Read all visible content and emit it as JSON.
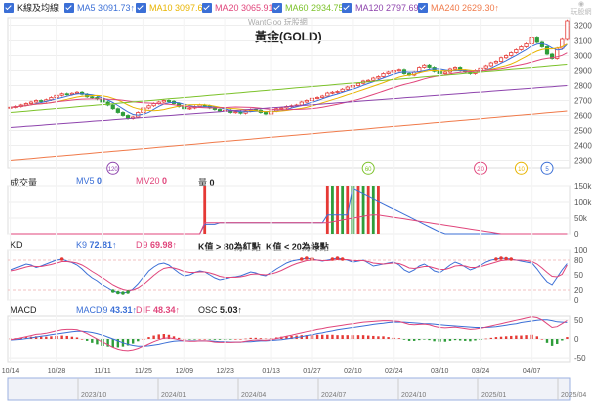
{
  "legend": {
    "main": "K線及均線",
    "ma5": "MA5 3091.73↑",
    "ma10": "MA10 3097.60↑",
    "ma20": "MA20 3065.91↑",
    "ma60": "MA60 2934.75↑",
    "ma120": "MA120 2797.69↑",
    "ma240": "MA240 2629.30↑"
  },
  "watermark": "WantGoo 玩股網",
  "logo": "玩股網",
  "title": "黃金(GOLD)",
  "volume": {
    "label": "成交量",
    "mv5": "MV5",
    "mv5_val": "0",
    "mv20": "MV20",
    "mv20_val": "0",
    "vol": "量",
    "vol_val": "0"
  },
  "kd": {
    "label": "KD",
    "k": "K9",
    "k_val": "72.81↑",
    "d": "D9",
    "d_val": "69.98↑",
    "note1": "K值 > 80為紅點",
    "note2": "K值 < 20為綠點"
  },
  "macd": {
    "label": "MACD",
    "macd": "MACD9",
    "macd_val": "43.31↑",
    "dif": "DIF",
    "dif_val": "48.34↑",
    "osc": "OSC",
    "osc_val": "5.03↑"
  },
  "ma_markers": [
    "120",
    "60",
    "20",
    "10",
    "5"
  ],
  "colors": {
    "ma5": "#3b6fd6",
    "ma10": "#e8b400",
    "ma20": "#e0457b",
    "ma60": "#7cc22a",
    "ma120": "#8e44ad",
    "ma240": "#f07a4a",
    "up": "#e53935",
    "down": "#2e9d3a"
  },
  "chart_data": {
    "type": "candlestick",
    "x_ticks": [
      "10/14",
      "10/28",
      "11/11",
      "11/25",
      "12/09",
      "12/23",
      "01/13",
      "01/27",
      "02/10",
      "02/24",
      "03/10",
      "03/24",
      "04/07"
    ],
    "price_ticks": [
      2300,
      2400,
      2500,
      2600,
      2700,
      2800,
      2900,
      3000,
      3100,
      3200
    ],
    "volume_ticks": [
      "150k",
      "100k",
      "50k",
      "0"
    ],
    "kd_ticks": [
      100,
      80,
      50,
      20,
      0
    ],
    "macd_ticks": [
      50,
      0,
      -50
    ],
    "timeline": [
      "2023/10",
      "2024/01",
      "2024/04",
      "2024/07",
      "2024/10",
      "2025/01",
      "2025/04"
    ],
    "close": [
      2655,
      2660,
      2670,
      2680,
      2690,
      2700,
      2695,
      2705,
      2720,
      2735,
      2745,
      2740,
      2748,
      2755,
      2742,
      2725,
      2720,
      2710,
      2690,
      2670,
      2645,
      2620,
      2600,
      2580,
      2590,
      2620,
      2650,
      2665,
      2680,
      2690,
      2700,
      2695,
      2680,
      2660,
      2645,
      2650,
      2660,
      2670,
      2665,
      2650,
      2640,
      2630,
      2635,
      2620,
      2625,
      2615,
      2630,
      2640,
      2635,
      2620,
      2610,
      2630,
      2645,
      2650,
      2660,
      2665,
      2670,
      2690,
      2700,
      2715,
      2720,
      2730,
      2750,
      2755,
      2760,
      2775,
      2790,
      2800,
      2815,
      2830,
      2835,
      2850,
      2860,
      2880,
      2890,
      2900,
      2905,
      2880,
      2870,
      2890,
      2920,
      2935,
      2920,
      2895,
      2880,
      2890,
      2910,
      2920,
      2900,
      2890,
      2880,
      2900,
      2915,
      2930,
      2950,
      2960,
      2985,
      3000,
      3020,
      3040,
      3060,
      3080,
      3120,
      3090,
      3060,
      3010,
      2980,
      3050,
      3110,
      3230
    ],
    "kd_k": [
      60,
      64,
      68,
      72,
      70,
      65,
      68,
      72,
      76,
      80,
      82,
      78,
      75,
      70,
      62,
      52,
      44,
      38,
      30,
      24,
      18,
      15,
      14,
      16,
      22,
      32,
      45,
      58,
      66,
      72,
      74,
      70,
      62,
      54,
      48,
      50,
      55,
      58,
      56,
      50,
      44,
      40,
      42,
      45,
      46,
      48,
      52,
      56,
      54,
      50,
      48,
      55,
      62,
      68,
      74,
      78,
      80,
      82,
      84,
      82,
      80,
      78,
      80,
      82,
      84,
      82,
      80,
      76,
      78,
      80,
      74,
      68,
      70,
      72,
      74,
      76,
      70,
      60,
      55,
      60,
      68,
      72,
      66,
      58,
      55,
      62,
      70,
      76,
      72,
      66,
      60,
      64,
      70,
      76,
      80,
      82,
      84,
      83,
      82,
      80,
      78,
      76,
      74,
      62,
      48,
      36,
      30,
      45,
      60,
      72.81
    ],
    "kd_d": [
      58,
      60,
      63,
      66,
      68,
      67,
      67,
      69,
      71,
      74,
      77,
      77,
      76,
      74,
      70,
      64,
      57,
      51,
      44,
      37,
      30,
      25,
      21,
      19,
      20,
      24,
      31,
      40,
      49,
      57,
      63,
      65,
      64,
      61,
      57,
      55,
      55,
      56,
      56,
      54,
      51,
      47,
      45,
      45,
      45,
      46,
      48,
      51,
      52,
      51,
      50,
      52,
      55,
      59,
      64,
      69,
      73,
      76,
      79,
      80,
      80,
      79,
      79,
      80,
      81,
      81,
      81,
      79,
      79,
      79,
      77,
      74,
      73,
      72,
      73,
      74,
      73,
      69,
      64,
      63,
      65,
      67,
      67,
      64,
      61,
      61,
      64,
      68,
      69,
      68,
      65,
      65,
      67,
      70,
      73,
      76,
      79,
      80,
      81,
      80,
      80,
      79,
      77,
      72,
      64,
      55,
      47,
      46,
      51,
      69.98
    ],
    "macd_dif": [
      -2,
      0,
      3,
      6,
      9,
      12,
      13,
      15,
      18,
      21,
      24,
      25,
      25,
      24,
      20,
      14,
      7,
      0,
      -8,
      -15,
      -22,
      -27,
      -30,
      -31,
      -29,
      -25,
      -19,
      -13,
      -7,
      -2,
      2,
      3,
      1,
      -2,
      -5,
      -6,
      -6,
      -5,
      -5,
      -6,
      -8,
      -9,
      -9,
      -9,
      -8,
      -8,
      -6,
      -4,
      -3,
      -3,
      -4,
      -2,
      1,
      4,
      7,
      10,
      13,
      16,
      19,
      22,
      25,
      27,
      30,
      32,
      34,
      36,
      38,
      40,
      42,
      44,
      45,
      46,
      47,
      48,
      48,
      47,
      46,
      42,
      38,
      37,
      38,
      39,
      37,
      33,
      30,
      29,
      30,
      31,
      29,
      27,
      25,
      26,
      28,
      31,
      34,
      37,
      40,
      43,
      46,
      49,
      52,
      55,
      58,
      56,
      50,
      40,
      30,
      32,
      40,
      48.34
    ],
    "macd_signal": [
      -3,
      -2,
      -1,
      1,
      3,
      5,
      7,
      9,
      11,
      13,
      15,
      17,
      19,
      20,
      20,
      19,
      17,
      14,
      10,
      5,
      0,
      -5,
      -10,
      -14,
      -17,
      -19,
      -19,
      -18,
      -16,
      -14,
      -11,
      -8,
      -6,
      -5,
      -5,
      -5,
      -5,
      -5,
      -5,
      -5,
      -6,
      -7,
      -7,
      -8,
      -8,
      -8,
      -7,
      -7,
      -6,
      -5,
      -5,
      -4,
      -3,
      -2,
      0,
      2,
      4,
      6,
      9,
      11,
      14,
      16,
      19,
      21,
      24,
      26,
      28,
      30,
      32,
      34,
      36,
      38,
      40,
      41,
      43,
      44,
      44,
      44,
      43,
      42,
      41,
      40,
      40,
      39,
      37,
      36,
      35,
      34,
      33,
      32,
      31,
      30,
      30,
      30,
      31,
      32,
      34,
      36,
      38,
      40,
      43,
      45,
      47,
      49,
      50,
      50,
      48,
      45,
      44,
      43.31
    ],
    "ma_marker_points": [
      [
        20,
        2248
      ],
      [
        70,
        2248
      ],
      [
        92,
        2248
      ],
      [
        100,
        2248
      ],
      [
        105,
        2248
      ]
    ]
  }
}
